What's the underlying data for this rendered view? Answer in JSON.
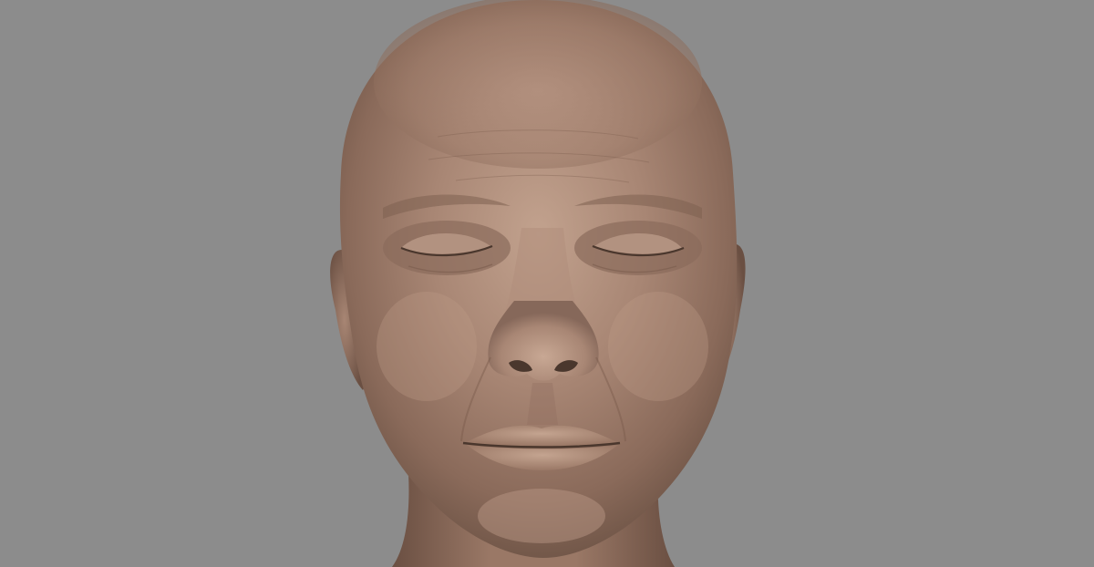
{
  "scene": {
    "subject": "sculpted-head-render",
    "colors": {
      "background": "#8c8c8c",
      "skin_base": "#a07e6c",
      "skin_light": "#c0a08c",
      "skin_shadow": "#6e5446",
      "skin_dark": "#4a372d"
    }
  }
}
